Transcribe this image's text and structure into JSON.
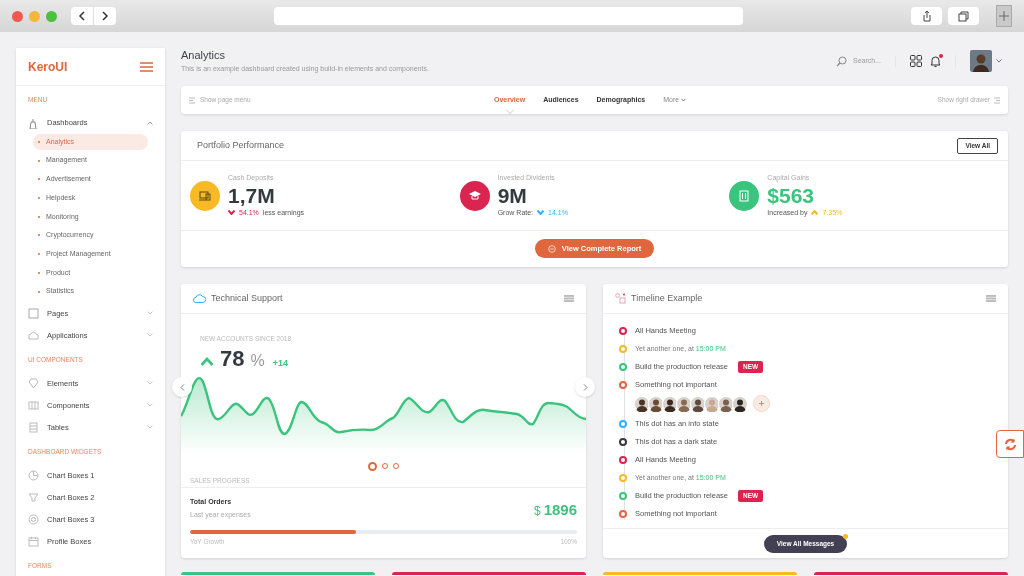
{
  "sidebar": {
    "logo": "KeroUI",
    "sections": [
      {
        "heading": "MENU",
        "items": [
          {
            "label": "Dashboards",
            "expanded": true,
            "children": [
              {
                "label": "Analytics",
                "selected": true
              },
              {
                "label": "Management",
                "selected": false
              },
              {
                "label": "Advertisement",
                "selected": false
              },
              {
                "label": "Helpdesk",
                "selected": false
              },
              {
                "label": "Monitoring",
                "selected": false
              },
              {
                "label": "Cryptocurrency",
                "selected": false
              },
              {
                "label": "Project Management",
                "selected": false
              },
              {
                "label": "Product",
                "selected": false
              },
              {
                "label": "Statistics",
                "selected": false
              }
            ]
          },
          {
            "label": "Pages",
            "expanded": false
          },
          {
            "label": "Applications",
            "expanded": false
          }
        ]
      },
      {
        "heading": "UI COMPONENTS",
        "items": [
          {
            "label": "Elements",
            "expanded": false
          },
          {
            "label": "Components",
            "expanded": false
          },
          {
            "label": "Tables",
            "expanded": false
          }
        ]
      },
      {
        "heading": "DASHBOARD WIDGETS",
        "items": [
          {
            "label": "Chart Boxes 1"
          },
          {
            "label": "Chart Boxes 2"
          },
          {
            "label": "Chart Boxes 3"
          },
          {
            "label": "Profile Boxes"
          }
        ]
      },
      {
        "heading": "FORMS"
      }
    ]
  },
  "header": {
    "title": "Analytics",
    "subtitle": "This is an example dashboard created using build-in elements and components.",
    "search": {
      "placeholder": "Search..."
    },
    "has_notification": true
  },
  "page_menu": {
    "left": "Show page menu",
    "tabs": [
      {
        "label": "Overview",
        "selected": true
      },
      {
        "label": "Audiences",
        "selected": false
      },
      {
        "label": "Demographics",
        "selected": false
      }
    ],
    "more": "More",
    "right": "Show right drawer"
  },
  "portfolio": {
    "title": "Portfolio Performance",
    "button": "View All",
    "stats": [
      {
        "label": "Cash Deposits",
        "value": "1,7M",
        "color": "#f7b924",
        "highlight": false,
        "delta": {
          "rising": false,
          "text": "54.1%",
          "color": "#d92550"
        },
        "after": "less earnings"
      },
      {
        "label": "Invested Dividents",
        "value": "9M",
        "color": "#d92550",
        "highlight": false,
        "before": "Grow Rate:",
        "delta": {
          "rising": false,
          "text": "14.1%",
          "color": "#30b1ff"
        }
      },
      {
        "label": "Capital Gains",
        "value": "$563",
        "color": "#3ac47d",
        "highlight": true,
        "before": "Increased by",
        "delta": {
          "rising": true,
          "text": "7.35%",
          "color": "#f7b924"
        }
      }
    ],
    "report_button": "View Complete Report"
  },
  "support": {
    "title": "Technical Support",
    "overline": "NEW ACCOUNTS SINCE 2018",
    "value": "78",
    "unit": "%",
    "change": "+14",
    "dots": [
      {
        "selected": true
      },
      {
        "selected": false
      },
      {
        "selected": false
      }
    ],
    "section": "SALES PROGRESS",
    "orders": {
      "title": "Total Orders",
      "subtitle": "Last year expenses",
      "currency": "$",
      "amount": "1896",
      "level": 0.43,
      "left_label": "YoY Growth",
      "right_label": "100%"
    }
  },
  "timeline": {
    "title": "Timeline Example",
    "items": [
      {
        "kind": "title",
        "text": "All Hands Meeting",
        "color": "#d92550"
      },
      {
        "kind": "note",
        "text": "Yet another one, at",
        "time": "15:00 PM",
        "color": "#f7b924"
      },
      {
        "kind": "title",
        "text": "Build the production release",
        "badge": "NEW",
        "color": "#3ac47d"
      },
      {
        "kind": "title",
        "text": "Something not important",
        "avatars": true,
        "color": "#e0663e"
      },
      {
        "kind": "title",
        "text": "This dot has an info state",
        "color": "#30b1ff"
      },
      {
        "kind": "title",
        "text": "This dot has a dark state",
        "color": "#343a40"
      },
      {
        "kind": "title",
        "text": "All Hands Meeting",
        "color": "#d92550"
      },
      {
        "kind": "note",
        "text": "Yet another one, at",
        "time": "15:00 PM",
        "color": "#f7b924"
      },
      {
        "kind": "title",
        "text": "Build the production release",
        "badge": "NEW",
        "color": "#3ac47d"
      },
      {
        "kind": "title",
        "text": "Something not important",
        "color": "#e0663e"
      }
    ],
    "button": "View All Messages"
  }
}
